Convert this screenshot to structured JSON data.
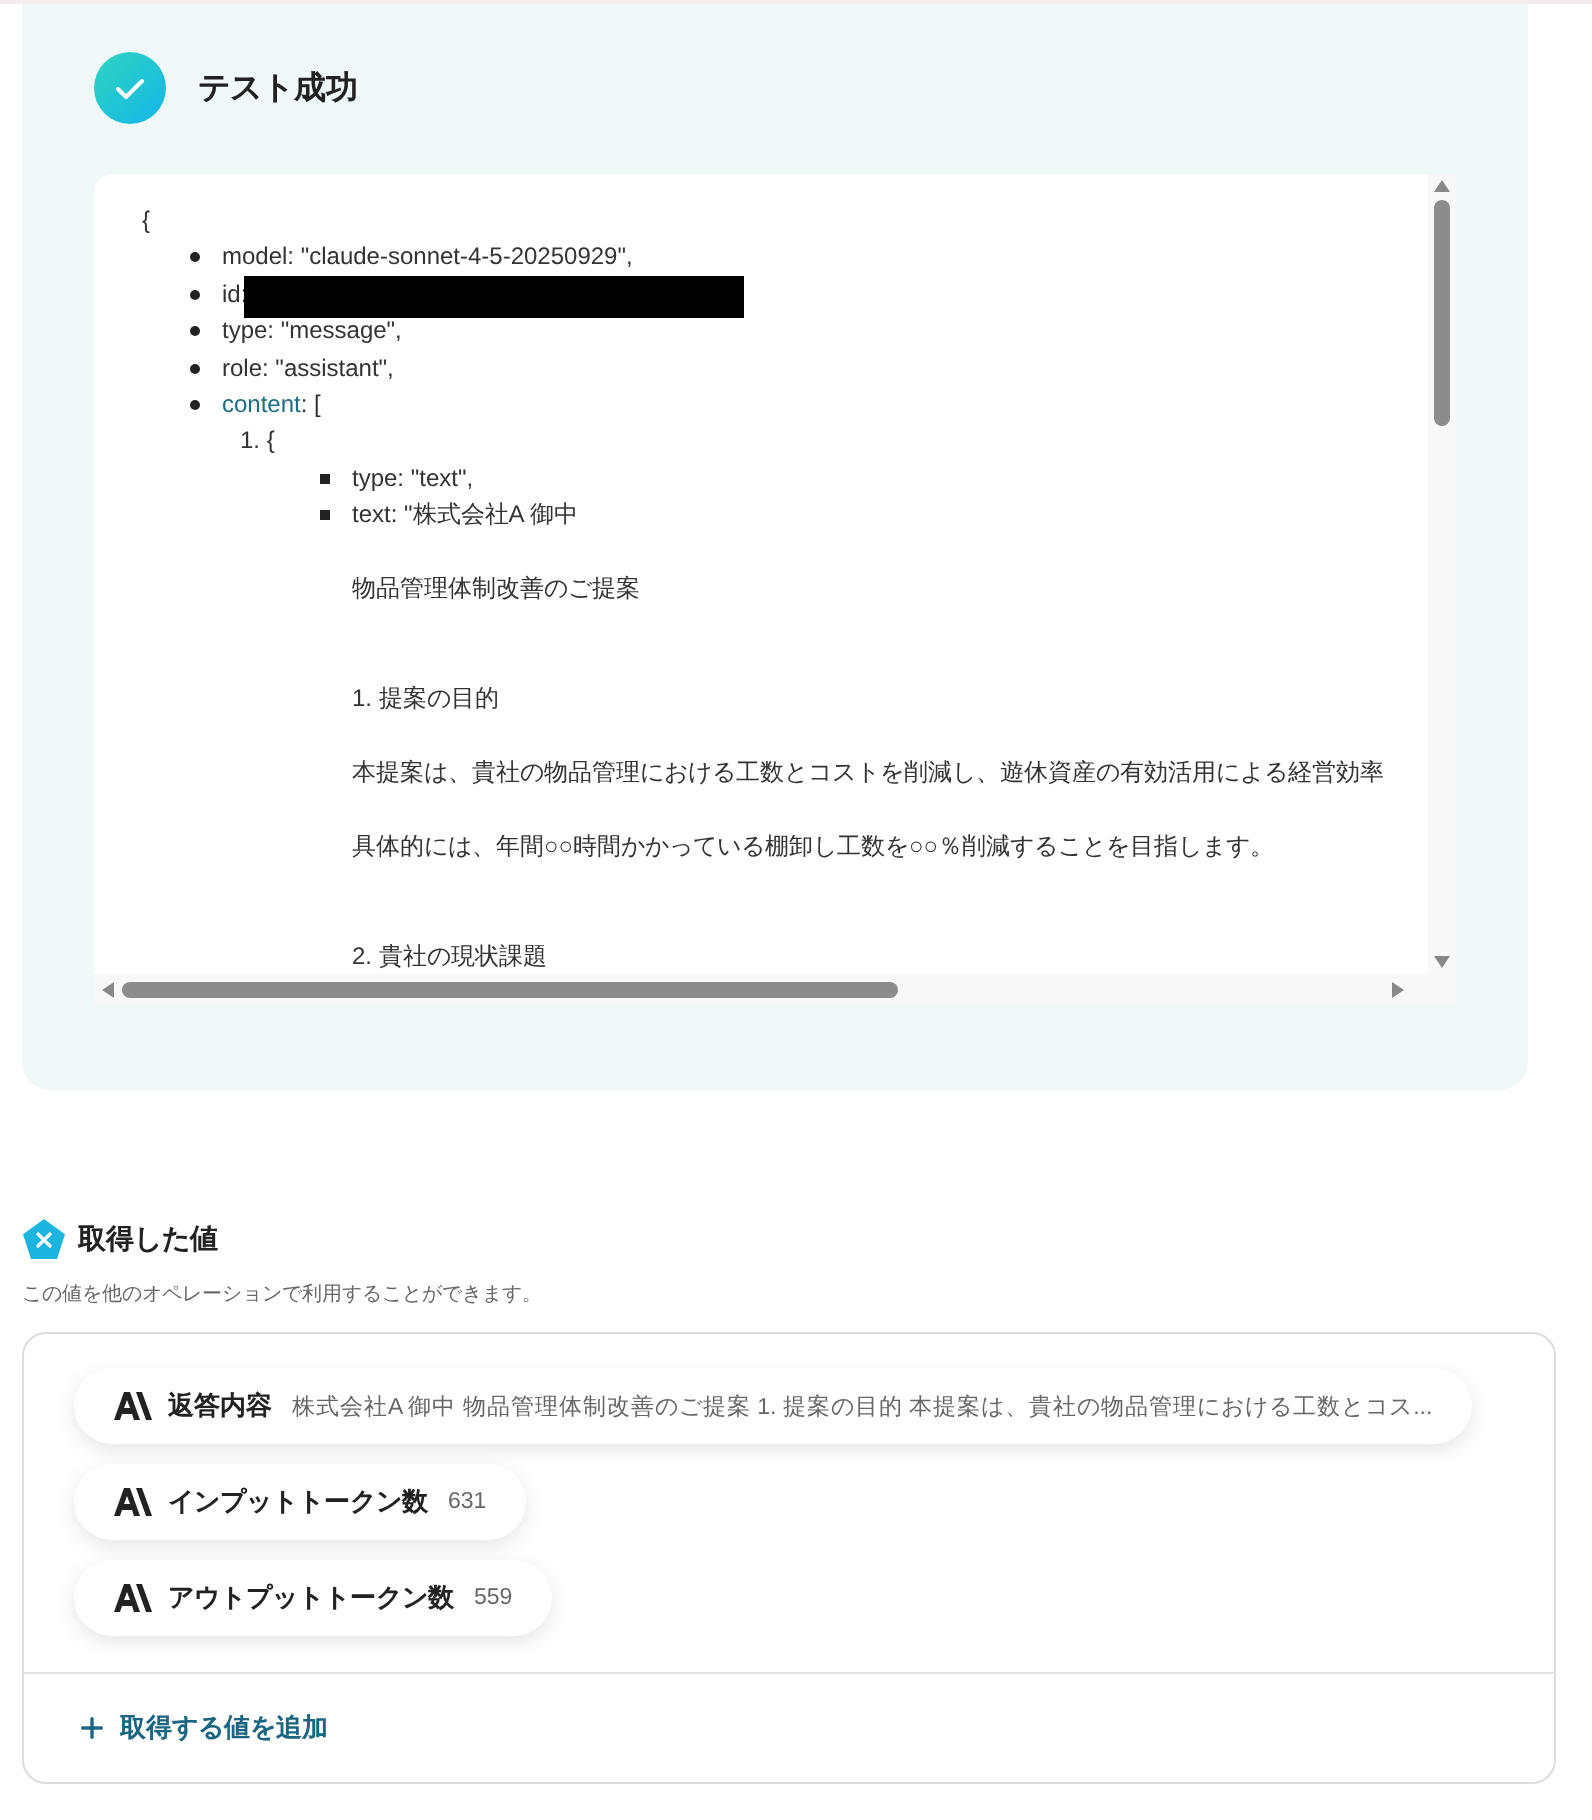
{
  "result": {
    "title": "テスト成功"
  },
  "response": {
    "open": "{",
    "fields": [
      {
        "kind": "plain",
        "text": "model: \"claude-sonnet-4-5-20250929\","
      },
      {
        "kind": "redacted",
        "text": "id:"
      },
      {
        "kind": "plain",
        "text": "type: \"message\","
      },
      {
        "kind": "plain",
        "text": "role: \"assistant\","
      },
      {
        "kind": "expandable",
        "key": "content",
        "text": ": [",
        "items": [
          {
            "marker": "1.",
            "open": "{",
            "fields": [
              {
                "text": "type: \"text\","
              },
              {
                "text": "text: \"株式会社A 御中",
                "lines": [
                  {
                    "kind": "title",
                    "text": "物品管理体制改善のご提案"
                  },
                  {
                    "kind": "heading",
                    "text": "1. 提案の目的"
                  },
                  {
                    "kind": "body",
                    "text": "本提案は、貴社の物品管理における工数とコストを削減し、遊休資産の有効活用による経営効率"
                  },
                  {
                    "kind": "body",
                    "text": "具体的には、年間○○時間かかっている棚卸し工数を○○％削減することを目指します。"
                  },
                  {
                    "kind": "heading",
                    "text": "2. 貴社の現状課題"
                  }
                ]
              }
            ]
          }
        ]
      }
    ]
  },
  "captured": {
    "title": "取得した値",
    "description": "この値を他のオペレーションで利用することができます。",
    "items": [
      {
        "label": "返答内容",
        "value": "株式会社A 御中 物品管理体制改善のご提案 1. 提案の目的 本提案は、貴社の物品管理における工数とコス..."
      },
      {
        "label": "インプットトークン数",
        "value": "631"
      },
      {
        "label": "アウトプットトークン数",
        "value": "559"
      }
    ],
    "add_label": "取得する値を追加"
  }
}
